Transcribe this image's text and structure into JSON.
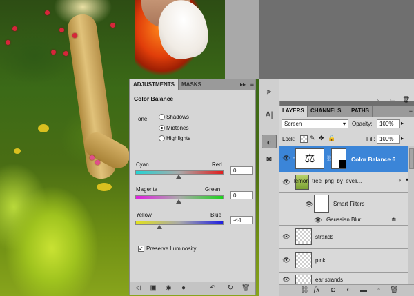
{
  "adjustments": {
    "tabs": [
      {
        "label": "ADJUSTMENTS"
      },
      {
        "label": "MASKS"
      }
    ],
    "menu_icon": "panel-menu-icon",
    "title": "Color Balance",
    "tone_label": "Tone:",
    "tone_options": [
      {
        "label": "Shadows",
        "selected": false
      },
      {
        "label": "Midtones",
        "selected": true
      },
      {
        "label": "Highlights",
        "selected": false
      }
    ],
    "sliders": [
      {
        "left": "Cyan",
        "right": "Red",
        "value": "0",
        "position": 0.5
      },
      {
        "left": "Magenta",
        "right": "Green",
        "value": "0",
        "position": 0.5
      },
      {
        "left": "Yellow",
        "right": "Blue",
        "value": "-44",
        "position": 0.28
      }
    ],
    "preserve_luminosity": {
      "label": "Preserve Luminosity",
      "checked": true
    }
  },
  "layers": {
    "tabs": [
      {
        "label": "LAYERS"
      },
      {
        "label": "CHANNELS"
      },
      {
        "label": "PATHS"
      }
    ],
    "blend_mode": "Screen",
    "opacity_label": "Opacity:",
    "opacity": "100%",
    "lock_label": "Lock:",
    "fill_label": "Fill:",
    "fill": "100%",
    "items": [
      {
        "name": "Color Balance 6",
        "selected": true
      },
      {
        "name": "lemon_tree_png_by_eveli..."
      },
      {
        "name": "Smart Filters"
      },
      {
        "name": "Gaussian Blur"
      },
      {
        "name": "strands"
      },
      {
        "name": "pink"
      },
      {
        "name": "ear strands"
      }
    ]
  },
  "colors": {
    "selection": "#3b85d8",
    "panel": "#d6d6d6",
    "tabbar": "#9a9a9a"
  }
}
